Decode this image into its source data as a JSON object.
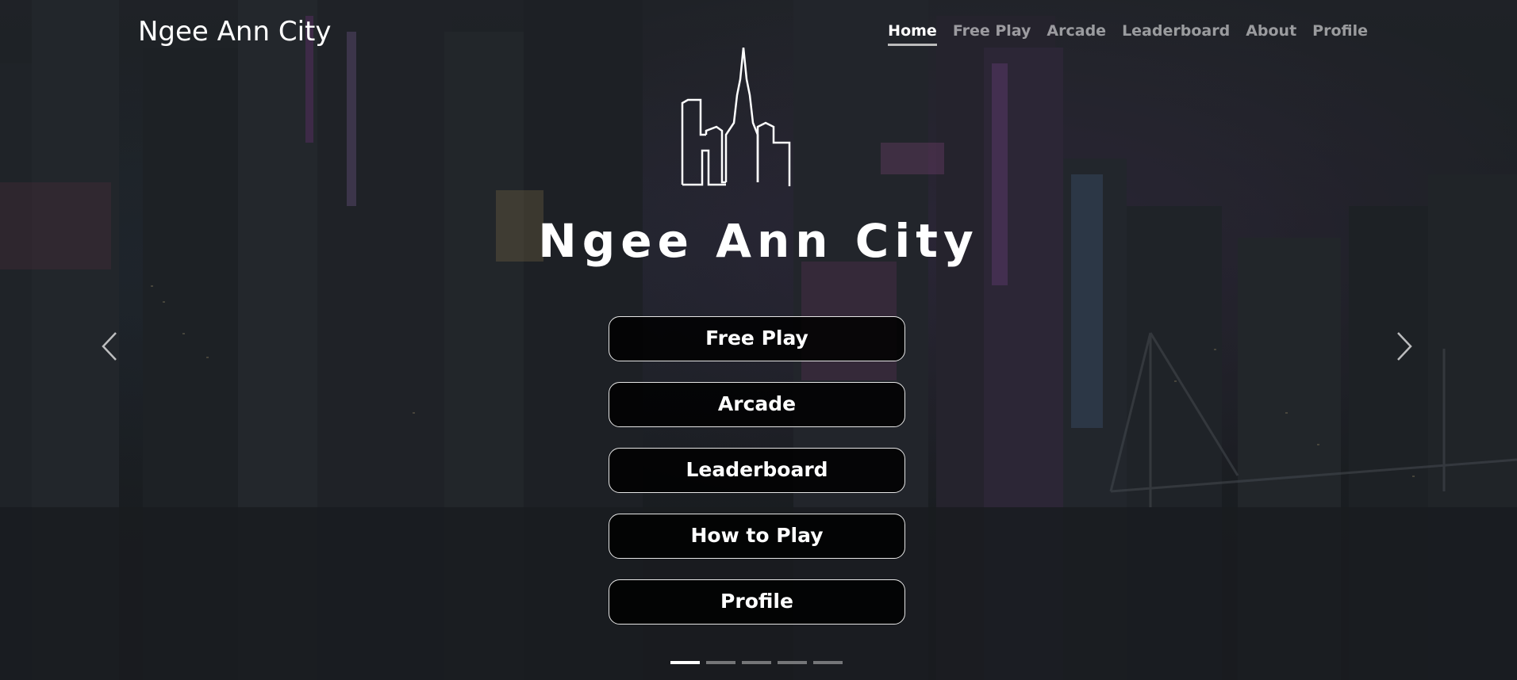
{
  "brand": {
    "title": "Ngee Ann City"
  },
  "nav": {
    "items": [
      {
        "label": "Home",
        "active": true
      },
      {
        "label": "Free Play",
        "active": false
      },
      {
        "label": "Arcade",
        "active": false
      },
      {
        "label": "Leaderboard",
        "active": false
      },
      {
        "label": "About",
        "active": false
      },
      {
        "label": "Profile",
        "active": false
      }
    ]
  },
  "logo": {
    "title": "Ngee Ann City",
    "icon": "city-skyline-icon"
  },
  "menu": {
    "buttons": [
      {
        "label": "Free Play"
      },
      {
        "label": "Arcade"
      },
      {
        "label": "Leaderboard"
      },
      {
        "label": "How to Play"
      },
      {
        "label": "Profile"
      }
    ]
  },
  "carousel": {
    "prev_icon": "chevron-left-icon",
    "next_icon": "chevron-right-icon",
    "slide_count": 5,
    "active_slide": 1
  },
  "colors": {
    "background": "#1f2327",
    "button_bg": "#000000",
    "button_border": "#e6e6e6",
    "nav_active": "#ffffff",
    "nav_inactive": "#8c8c8c"
  }
}
